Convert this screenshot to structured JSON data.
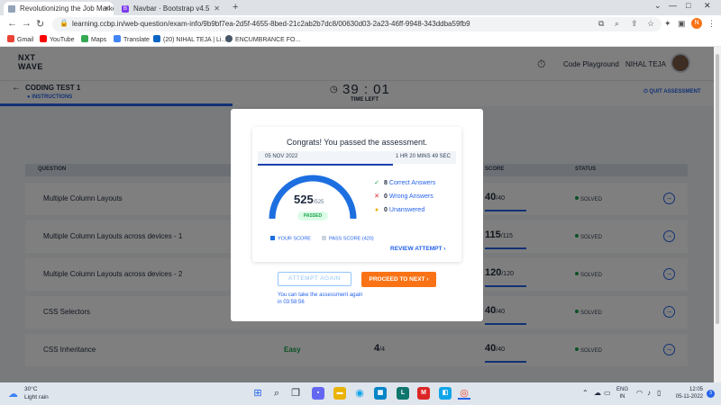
{
  "browser": {
    "tabs": [
      {
        "title": "Revolutionizing the Job Market |",
        "active": true
      },
      {
        "title": "Navbar · Bootstrap v4.5",
        "active": false
      }
    ],
    "url": "learning.ccbp.in/web-question/exam-info/9b9bf7ea-2d5f-4655-8bed-21c2ab2b7dc8/00630d03-2a23-46ff-9948-343ddba59fb9",
    "bookmarks": [
      "Gmail",
      "YouTube",
      "Maps",
      "Translate",
      "(20) NIHAL TEJA | Li...",
      "ENCUMBRANCE FO..."
    ],
    "profile_initial": "N"
  },
  "header": {
    "logo_line1": "NXT",
    "logo_line2": "WAVE",
    "code_playground": "Code Playground",
    "user_name": "NIHAL TEJA"
  },
  "test": {
    "title": "CODING TEST 1",
    "instructions": "INSTRUCTIONS",
    "time": "39 : 01",
    "time_left_label": "TIME LEFT",
    "quit_label": "QUIT ASSESSMENT"
  },
  "table": {
    "headers": {
      "question": "QUESTION",
      "score": "SCORE",
      "status": "STATUS"
    },
    "rows": [
      {
        "name": "Multiple Column Layouts",
        "difficulty": "",
        "tests": "",
        "tests_max": "",
        "score": "40",
        "score_max": "/40",
        "status": "SOLVED"
      },
      {
        "name": "Multiple Column Layouts across devices - 1",
        "difficulty": "",
        "tests": "",
        "tests_max": "",
        "score": "115",
        "score_max": "/115",
        "status": "SOLVED"
      },
      {
        "name": "Multiple Column Layouts across devices - 2",
        "difficulty": "",
        "tests": "",
        "tests_max": "",
        "score": "120",
        "score_max": "/120",
        "status": "SOLVED"
      },
      {
        "name": "CSS Selectors",
        "difficulty": "",
        "tests": "",
        "tests_max": "",
        "score": "40",
        "score_max": "/40",
        "status": "SOLVED"
      },
      {
        "name": "CSS Inheritance",
        "difficulty": "Easy",
        "tests": "4",
        "tests_max": "/4",
        "score": "40",
        "score_max": "/40",
        "status": "SOLVED"
      }
    ]
  },
  "modal": {
    "congrats": "Congrats! You passed the assessment.",
    "date": "05 NOV 2022",
    "duration": "1 HR 20 MINS 49 SEC",
    "score": "525",
    "score_max": "/525",
    "score_fraction": 1.0,
    "passed_label": "PASSED",
    "correct_count": "8",
    "correct_label": "Correct Answers",
    "wrong_count": "0",
    "wrong_label": "Wrong Answers",
    "unanswered_count": "0",
    "unanswered_label": "Unanswered",
    "legend_your_score": "YOUR SCORE",
    "legend_pass_score": "PASS SCORE (420)",
    "review_label": "REVIEW ATTEMPT",
    "attempt_again_label": "ATTEMPT AGAIN",
    "proceed_label": "PROCEED TO NEXT",
    "retake_note": "You can take the assessment again in 03:58:56",
    "colors": {
      "accent": "#2563eb",
      "cta": "#f97316",
      "success": "#16a34a",
      "danger": "#dc2626",
      "warning": "#eab308"
    }
  },
  "taskbar": {
    "temperature": "30°C",
    "weather": "Light rain",
    "lang_line1": "ENG",
    "lang_line2": "IN",
    "time": "12:05",
    "date": "05-11-2022",
    "notification_count": "3"
  }
}
